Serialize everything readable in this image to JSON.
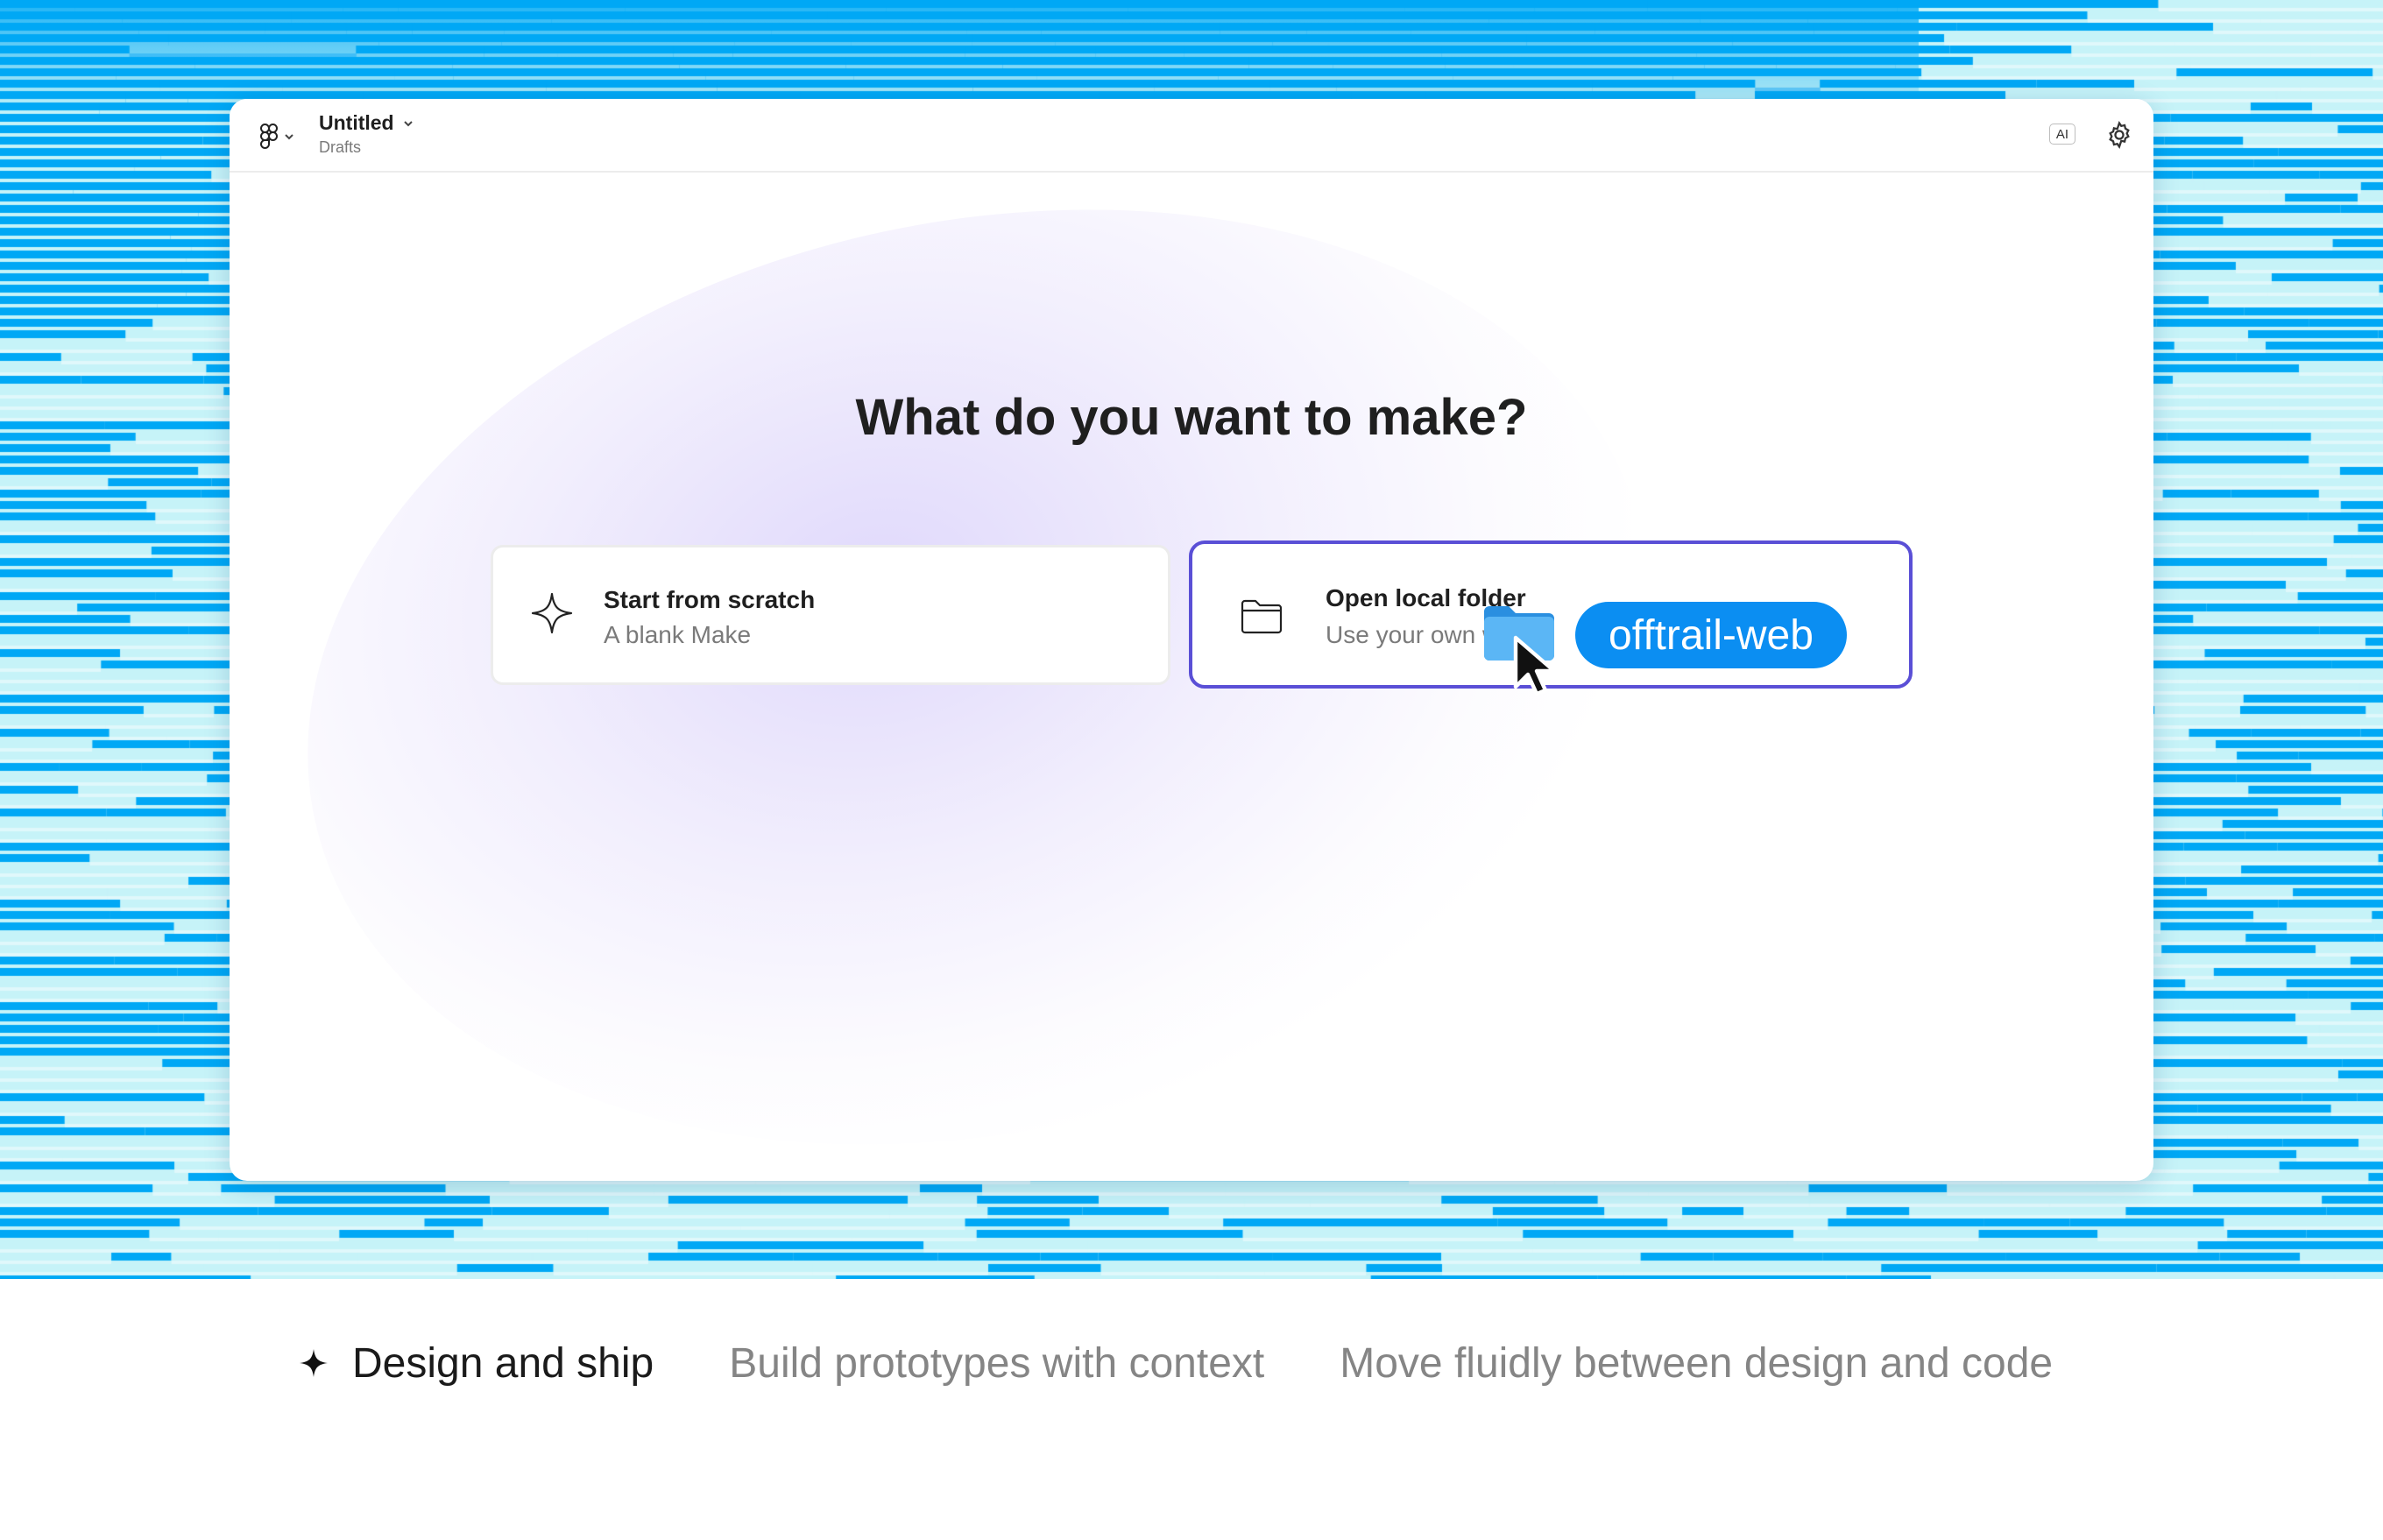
{
  "window": {
    "file_title": "Untitled",
    "file_location": "Drafts",
    "ai_badge": "AI"
  },
  "main": {
    "headline": "What do you want to make?",
    "options": [
      {
        "title": "Start from scratch",
        "description": "A blank Make",
        "icon": "sparkle-outline-icon"
      },
      {
        "title": "Open local folder",
        "description": "Use your own web",
        "icon": "folder-icon"
      }
    ]
  },
  "drag_overlay": {
    "label": "offtrail-web",
    "icon": "folder-icon"
  },
  "tabs": [
    {
      "label": "Design and ship",
      "active": true,
      "icon": "sparkle-icon"
    },
    {
      "label": "Build prototypes with context",
      "active": false
    },
    {
      "label": "Move fluidly between design and code",
      "active": false
    }
  ],
  "colors": {
    "hero_blue": "#00a8f5",
    "hero_cyan": "#c6f3f8",
    "selection_border": "#5a4fd6",
    "pill_blue": "#0b8ef2"
  }
}
